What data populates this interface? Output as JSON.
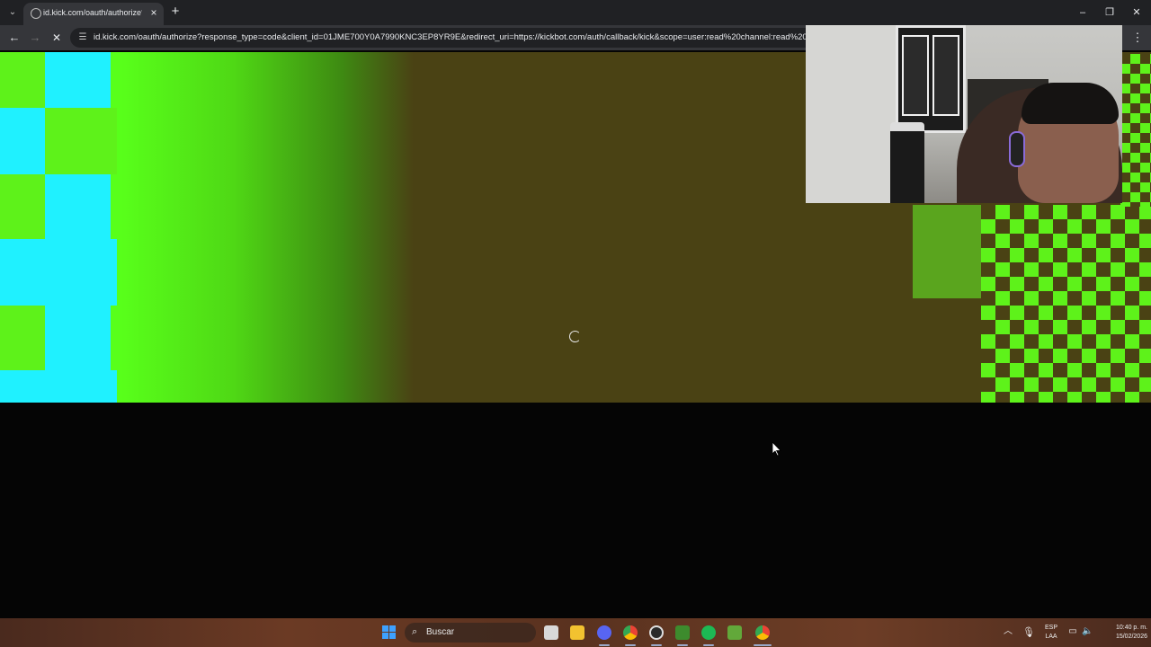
{
  "browser": {
    "tab_title": "id.kick.com/oauth/authorize?re",
    "url": "id.kick.com/oauth/authorize?response_type=code&client_id=01JME700Y0A7990KNC3EP8YR9E&redirect_uri=https://kickbot.com/auth/callback/kick&scope=user:read%20channel:read%20chan",
    "tab_menu_icon": "chevron-down-icon",
    "close_tab_icon": "close-icon",
    "new_tab_icon": "plus-icon",
    "back_icon": "arrow-left-icon",
    "forward_icon": "arrow-right-icon",
    "stop_icon": "close-icon",
    "site_info_icon": "tune-icon",
    "menu_icon": "kebab-icon",
    "loading": true
  },
  "window_controls": {
    "minimize_icon": "minimize-icon",
    "restore_icon": "restore-icon",
    "close_icon": "close-icon"
  },
  "page": {
    "spinner_icon": "loading-spinner-icon",
    "colors": {
      "lime": "#5ef21a",
      "cyan": "#1ff1ff",
      "olive": "#4a4214",
      "mid_green": "#5aa51e"
    }
  },
  "taskbar": {
    "search_placeholder": "Buscar",
    "apps": [
      "windows-start-icon",
      "task-view-icon",
      "file-explorer-icon",
      "discord-icon",
      "chrome-icon",
      "obs-icon",
      "minecraft-icon",
      "spotify-icon",
      "minecraft-launcher-icon",
      "chrome-profile-icon"
    ],
    "tray": {
      "lang_line1": "ESP",
      "lang_line2": "LAA",
      "time": "10:40 p. m.",
      "date": "15/02/2026"
    }
  }
}
